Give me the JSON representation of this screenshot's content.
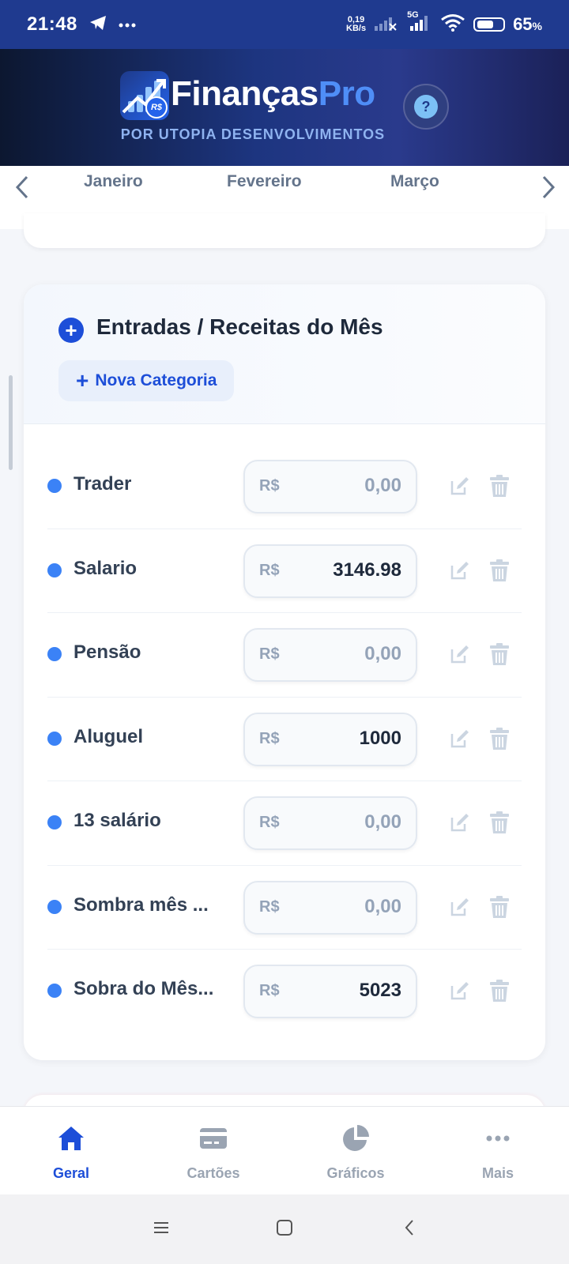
{
  "status_bar": {
    "time": "21:48",
    "net_speed_top": "0,19",
    "net_speed_bottom": "KB/s",
    "network_label": "5G",
    "battery_percent": "65",
    "battery_level": 65,
    "icons": [
      "telegram-icon",
      "more-dots-icon",
      "signal-icon",
      "wifi-icon",
      "battery-icon"
    ]
  },
  "header": {
    "logo_badge": "R$",
    "title_main": "Finanças",
    "title_accent": "Pro",
    "subtitle": "POR UTOPIA DESENVOLVIMENTOS",
    "help_label": "?"
  },
  "month_selector": {
    "months": [
      "Janeiro",
      "Fevereiro",
      "Março"
    ]
  },
  "income_section": {
    "title": "Entradas / Receitas do Mês",
    "new_category_label": "Nova Categoria",
    "currency": "R$",
    "items": [
      {
        "label": "Trader",
        "value": "0,00",
        "placeholder": true
      },
      {
        "label": "Salario",
        "value": "3146.98",
        "placeholder": false
      },
      {
        "label": "Pensão",
        "value": "0,00",
        "placeholder": true
      },
      {
        "label": "Aluguel",
        "value": "1000",
        "placeholder": false
      },
      {
        "label": "13 salário",
        "value": "0,00",
        "placeholder": true
      },
      {
        "label": "Sombra mês ...",
        "value": "0,00",
        "placeholder": true
      },
      {
        "label": "Sobra do Mês...",
        "value": "5023",
        "placeholder": false
      }
    ]
  },
  "bottom_nav": {
    "items": [
      {
        "label": "Geral",
        "icon": "home-icon",
        "active": true
      },
      {
        "label": "Cartões",
        "icon": "credit-card-icon",
        "active": false
      },
      {
        "label": "Gráficos",
        "icon": "pie-chart-icon",
        "active": false
      },
      {
        "label": "Mais",
        "icon": "more-dots-icon",
        "active": false
      }
    ]
  },
  "colors": {
    "accent": "#1d4ed8",
    "dot": "#3b82f6",
    "header_dark": "#0c1730",
    "status_bar": "#1f3a8f"
  }
}
